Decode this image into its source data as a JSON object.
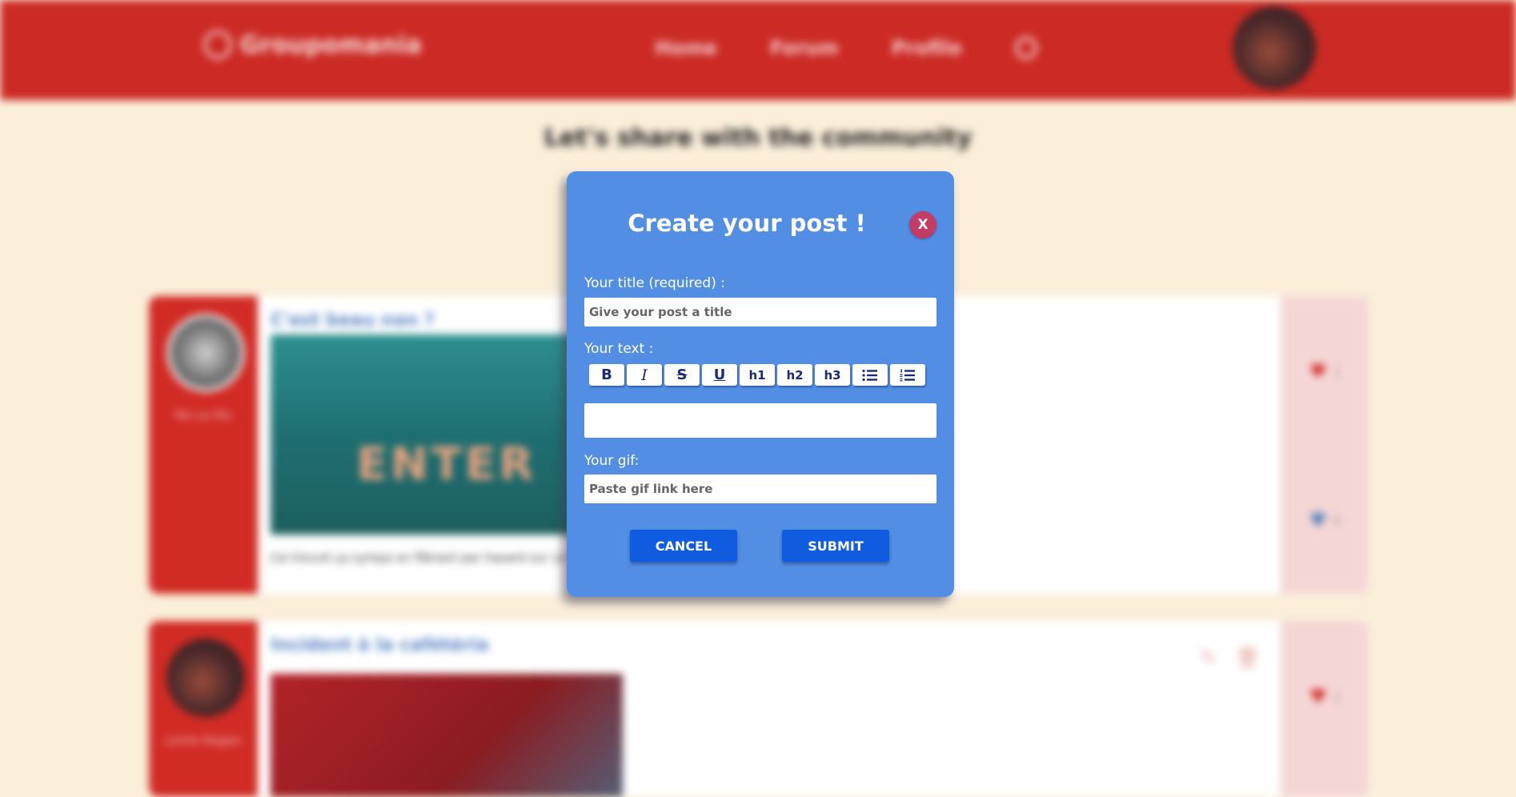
{
  "header": {
    "brand": "Groupomania",
    "nav": [
      "Home",
      "Forum",
      "Profile"
    ]
  },
  "page": {
    "heading": "Let's share with the community"
  },
  "posts": [
    {
      "title": "C'est beau non ?",
      "author": "Mo Le Mo",
      "image_text": "ENTER",
      "text": "J'ai trouvé ça sympa en flânant par hasard sur ce site",
      "likes": "1",
      "dislikes": "0"
    },
    {
      "title": "Incident à la cafétéria",
      "author": "Leslie Nagan",
      "likes": "1"
    }
  ],
  "modal": {
    "title": "Create your post !",
    "close_label": "X",
    "title_label": "Your title (required) :",
    "title_placeholder": "Give your post a title",
    "text_label": "Your text :",
    "toolbar": {
      "h1": "h1",
      "h2": "h2",
      "h3": "h3"
    },
    "gif_label": "Your gif:",
    "gif_placeholder": "Paste gif link here",
    "cancel_label": "CANCEL",
    "submit_label": "SUBMIT"
  },
  "colors": {
    "header": "#cc2a24",
    "background": "#fbefda",
    "modal": "#528fe4",
    "button": "#0f5ce0",
    "close": "#c33c66"
  }
}
